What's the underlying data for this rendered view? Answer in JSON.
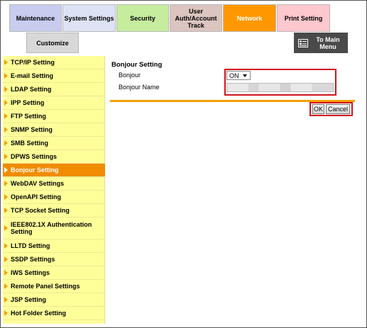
{
  "tabs": {
    "maintenance": "Maintenance",
    "system_settings": "System Settings",
    "security": "Security",
    "user_auth": "User\nAuth/Account\nTrack",
    "network": "Network",
    "print_setting": "Print Setting",
    "customize": "Customize"
  },
  "main_menu": {
    "label": "To Main\nMenu",
    "icon": "main-menu-icon"
  },
  "sidebar": {
    "items": [
      {
        "label": "TCP/IP Setting"
      },
      {
        "label": "E-mail Setting"
      },
      {
        "label": "LDAP Setting"
      },
      {
        "label": "IPP Setting"
      },
      {
        "label": "FTP Setting"
      },
      {
        "label": "SNMP Setting"
      },
      {
        "label": "SMB Setting"
      },
      {
        "label": "DPWS Settings"
      },
      {
        "label": "Bonjour Setting"
      },
      {
        "label": "WebDAV Settings"
      },
      {
        "label": "OpenAPI Setting"
      },
      {
        "label": "TCP Socket Setting"
      },
      {
        "label": "IEEE802.1X Authentication Setting"
      },
      {
        "label": "LLTD Setting"
      },
      {
        "label": "SSDP Settings"
      },
      {
        "label": "IWS Settings"
      },
      {
        "label": "Remote Panel Settings"
      },
      {
        "label": "JSP Setting"
      },
      {
        "label": "Hot Folder Setting"
      }
    ],
    "active_index": 8
  },
  "content": {
    "title": "Bonjour Setting",
    "bonjour_label": "Bonjour",
    "bonjour_value": "ON",
    "bonjour_name_label": "Bonjour Name",
    "bonjour_name_value": ""
  },
  "buttons": {
    "ok": "OK",
    "cancel": "Cancel"
  },
  "colors": {
    "accent": "#f5a000",
    "active": "#f08c00",
    "highlight": "#d0121b",
    "sidebar": "#ffff9a"
  }
}
